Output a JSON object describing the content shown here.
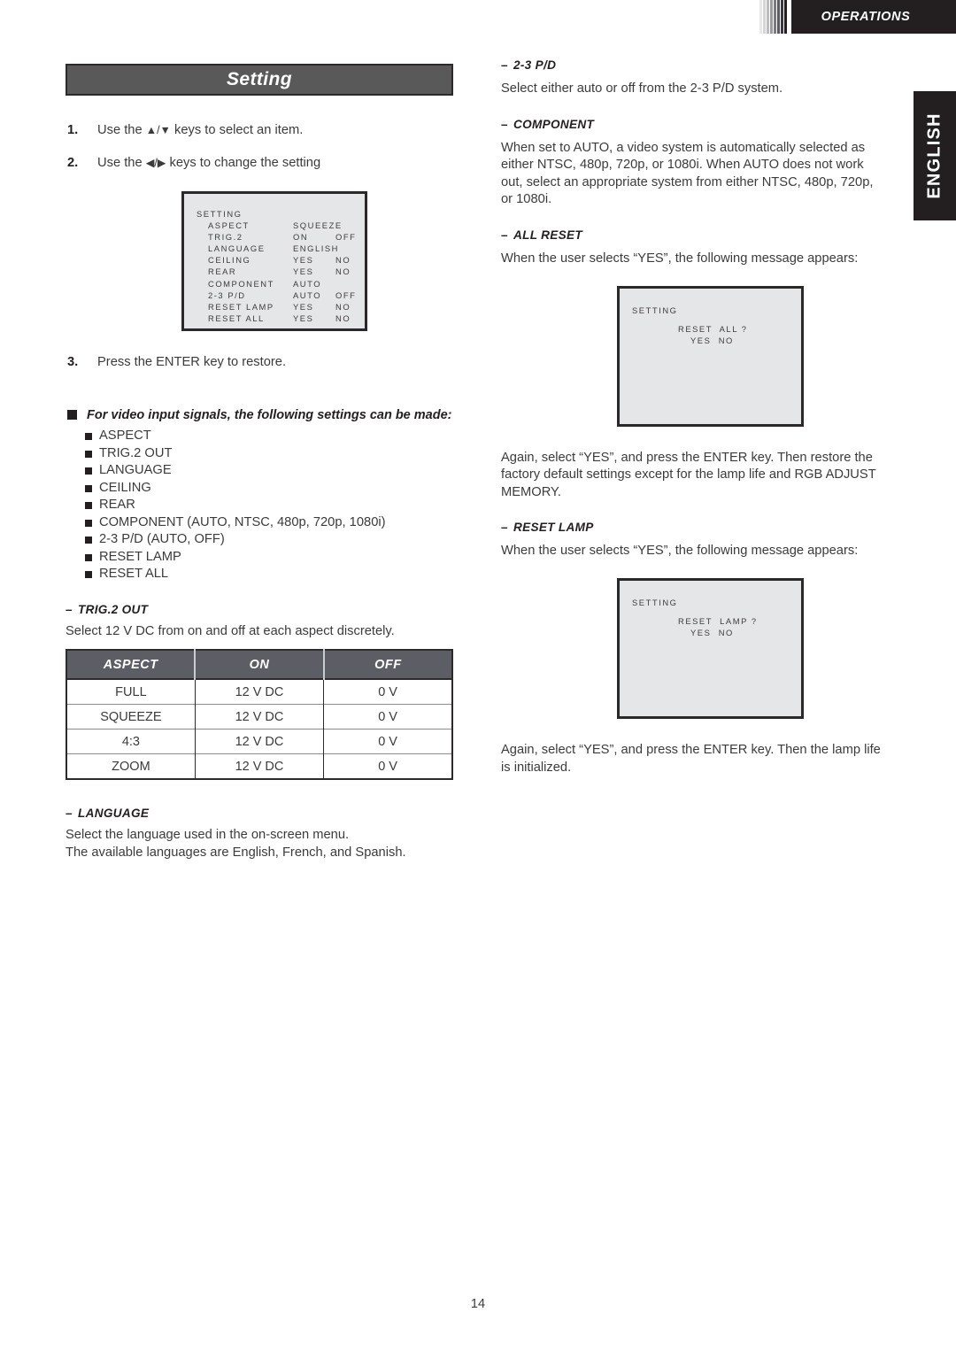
{
  "header": {
    "section_label": "OPERATIONS",
    "language_tab": "ENGLISH",
    "stripe_colors": [
      "#e9e9ea",
      "#d6d6d7",
      "#bcbcbe",
      "#9c9c9f",
      "#7b7b7f",
      "#5a5a5f",
      "#3a3a3e",
      "#231f20"
    ]
  },
  "colors": {
    "title_bar_bg": "#595959",
    "table_header_bg": "#5d5d66",
    "osd_bg": "#e4e6e7",
    "ink": "#231f20",
    "body_text": "#3b3b3b"
  },
  "left": {
    "title": "Setting",
    "steps": [
      {
        "num": "1.",
        "pre": "Use the ",
        "keys": "▲/▼",
        "post": " keys to select an item."
      },
      {
        "num": "2.",
        "pre": "Use the ",
        "keys": "◀/▶",
        "post": " keys to change the setting"
      },
      {
        "num": "3.",
        "pre": "",
        "keys": "",
        "post": "Press the ENTER key to restore.",
        "full": "Press the ENTER key to restore."
      }
    ],
    "osd_menu": {
      "title": "SETTING",
      "rows": [
        {
          "label": "ASPECT",
          "v1": "SQUEEZE",
          "v2": ""
        },
        {
          "label": "TRIG.2",
          "v1": "ON",
          "v2": "OFF"
        },
        {
          "label": "LANGUAGE",
          "v1": "ENGLISH",
          "v2": ""
        },
        {
          "label": "CEILING",
          "v1": "YES",
          "v2": "NO"
        },
        {
          "label": "REAR",
          "v1": "YES",
          "v2": "NO"
        },
        {
          "label": "COMPONENT",
          "v1": "AUTO",
          "v2": ""
        },
        {
          "label": "2-3 P/D",
          "v1": "AUTO",
          "v2": "OFF"
        },
        {
          "label": "RESET LAMP",
          "v1": "YES",
          "v2": "NO"
        },
        {
          "label": "RESET ALL",
          "v1": "YES",
          "v2": "NO"
        }
      ]
    },
    "video_block": {
      "heading": "For video input signals, the following settings can be made:",
      "items": [
        "ASPECT",
        "TRIG.2 OUT",
        "LANGUAGE",
        "CEILING",
        "REAR",
        "COMPONENT (AUTO, NTSC, 480p, 720p, 1080i)",
        "2-3 P/D (AUTO, OFF)",
        "RESET LAMP",
        "RESET ALL"
      ]
    },
    "trig2": {
      "heading": "TRIG.2 OUT",
      "body": "Select 12 V DC from on and off at each aspect discretely.",
      "table": {
        "columns": [
          "ASPECT",
          "ON",
          "OFF"
        ],
        "rows": [
          [
            "FULL",
            "12 V DC",
            "0 V"
          ],
          [
            "SQUEEZE",
            "12 V DC",
            "0 V"
          ],
          [
            "4:3",
            "12 V DC",
            "0 V"
          ],
          [
            "ZOOM",
            "12 V DC",
            "0 V"
          ]
        ]
      }
    },
    "language": {
      "heading": "LANGUAGE",
      "body_line1": "Select the language used in the on-screen menu.",
      "body_line2": "The available languages are English, French, and Spanish."
    }
  },
  "right": {
    "pd23": {
      "heading": "2-3 P/D",
      "body": "Select either auto or off from the 2-3 P/D system."
    },
    "component": {
      "heading": "COMPONENT",
      "body": "When set to AUTO, a video system is automatically selected as either NTSC, 480p, 720p, or 1080i. When AUTO does not work out, select an appropriate system from either NTSC, 480p, 720p, or 1080i."
    },
    "all_reset": {
      "heading": "ALL RESET",
      "body": "When the user selects “YES”, the following message appears:",
      "dialog": {
        "title": "SETTING",
        "prompt": "RESET  ALL ?",
        "options": "YES  NO"
      },
      "after": "Again, select “YES”, and press the ENTER key. Then restore the factory default settings except for the lamp life and RGB ADJUST MEMORY."
    },
    "reset_lamp": {
      "heading": "RESET LAMP",
      "body": "When the user selects “YES”, the following message appears:",
      "dialog": {
        "title": "SETTING",
        "prompt": "RESET  LAMP ?",
        "options": "YES  NO"
      },
      "after": "Again, select “YES”, and press the ENTER key. Then the lamp life is initialized."
    }
  },
  "footer": {
    "page_number": "14"
  }
}
